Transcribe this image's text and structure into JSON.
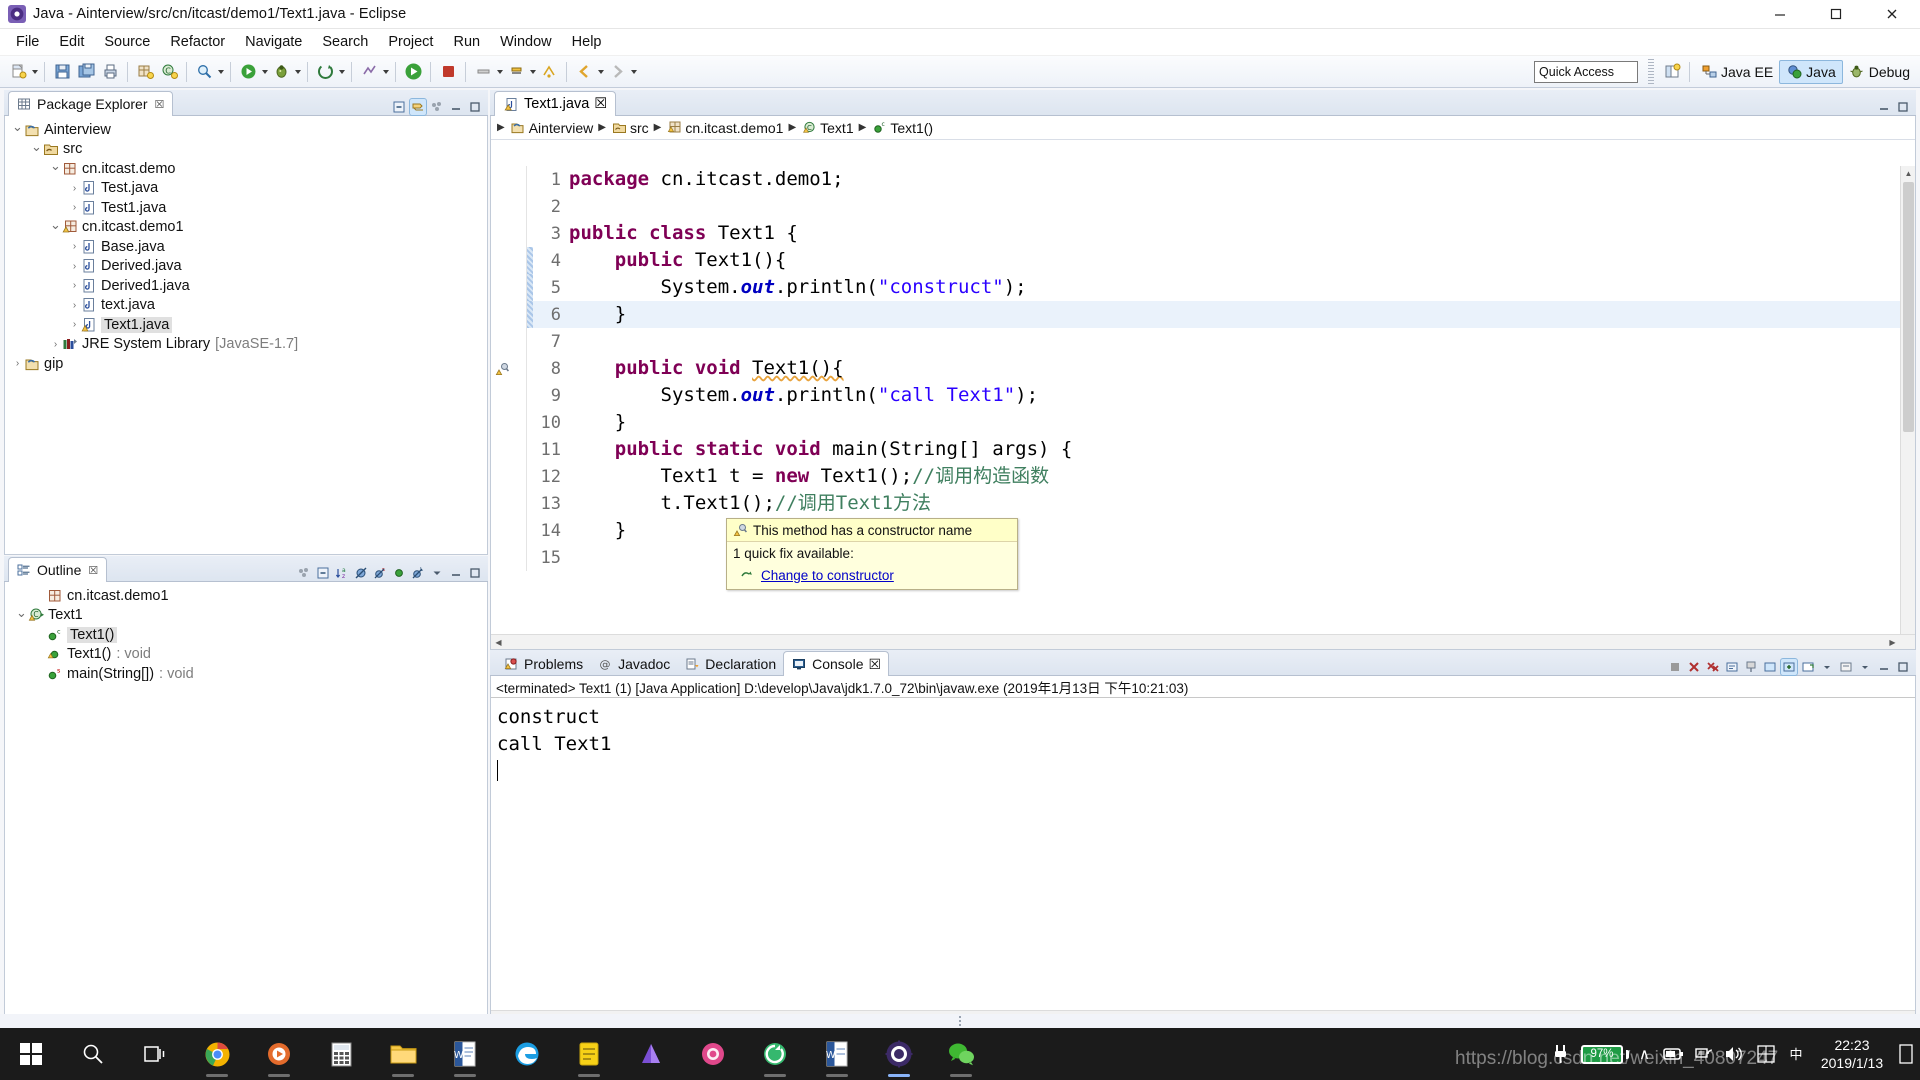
{
  "window": {
    "title": "Java - Ainterview/src/cn/itcast/demo1/Text1.java - Eclipse",
    "app_icon": "eclipse-icon",
    "minimize": "─",
    "maximize": "☐",
    "close": "✕"
  },
  "menubar": {
    "items": [
      {
        "label": "File"
      },
      {
        "label": "Edit"
      },
      {
        "label": "Source"
      },
      {
        "label": "Refactor"
      },
      {
        "label": "Navigate"
      },
      {
        "label": "Search"
      },
      {
        "label": "Project"
      },
      {
        "label": "Run"
      },
      {
        "label": "Window"
      },
      {
        "label": "Help"
      }
    ]
  },
  "toolbar": {
    "quick_access_placeholder": "Quick Access",
    "quick_access_value": "Quick Access",
    "perspectives": [
      {
        "label": "Java EE",
        "icon": "java-ee-perspective-icon",
        "active": false
      },
      {
        "label": "Java",
        "icon": "java-perspective-icon",
        "active": true
      },
      {
        "label": "Debug",
        "icon": "debug-perspective-icon",
        "active": false
      }
    ],
    "open_perspective_tooltip": "Open Perspective"
  },
  "package_explorer": {
    "tab_label": "Package Explorer",
    "close_glyph": "☒",
    "tools": [
      "collapse-all-icon",
      "link-with-editor-icon",
      "view-menu-icon",
      "minimize-icon",
      "maximize-icon"
    ],
    "tree": [
      {
        "depth": 0,
        "twisty": "⌄",
        "icon": "java-project-icon",
        "label": "Ainterview",
        "selected": false,
        "suffix": ""
      },
      {
        "depth": 1,
        "twisty": "⌄",
        "icon": "source-folder-icon",
        "label": "src",
        "selected": false,
        "suffix": ""
      },
      {
        "depth": 2,
        "twisty": "⌄",
        "icon": "package-icon",
        "label": "cn.itcast.demo",
        "selected": false,
        "suffix": ""
      },
      {
        "depth": 3,
        "twisty": "›",
        "icon": "java-file-icon",
        "label": "Test.java",
        "selected": false,
        "suffix": ""
      },
      {
        "depth": 3,
        "twisty": "›",
        "icon": "java-file-icon",
        "label": "Test1.java",
        "selected": false,
        "suffix": ""
      },
      {
        "depth": 2,
        "twisty": "⌄",
        "icon": "package-warning-icon",
        "label": "cn.itcast.demo1",
        "selected": false,
        "suffix": ""
      },
      {
        "depth": 3,
        "twisty": "›",
        "icon": "java-file-icon",
        "label": "Base.java",
        "selected": false,
        "suffix": ""
      },
      {
        "depth": 3,
        "twisty": "›",
        "icon": "java-file-icon",
        "label": "Derived.java",
        "selected": false,
        "suffix": ""
      },
      {
        "depth": 3,
        "twisty": "›",
        "icon": "java-file-icon",
        "label": "Derived1.java",
        "selected": false,
        "suffix": ""
      },
      {
        "depth": 3,
        "twisty": "›",
        "icon": "java-file-icon",
        "label": "text.java",
        "selected": false,
        "suffix": ""
      },
      {
        "depth": 3,
        "twisty": "›",
        "icon": "java-file-warning-icon",
        "label": "Text1.java",
        "selected": true,
        "suffix": ""
      },
      {
        "depth": 2,
        "twisty": "›",
        "icon": "jre-library-icon",
        "label": "JRE System Library",
        "selected": false,
        "suffix": "[JavaSE-1.7]"
      },
      {
        "depth": 0,
        "twisty": "›",
        "icon": "java-project-icon",
        "label": "gip",
        "selected": false,
        "suffix": ""
      }
    ]
  },
  "outline": {
    "tab_label": "Outline",
    "close_glyph": "☒",
    "tools": [
      "view-menu-icon",
      "collapse-all-icon",
      "sort-icon",
      "hide-fields-icon",
      "hide-static-icon",
      "hide-nonpublic-icon",
      "hide-local-icon"
    ],
    "tree": [
      {
        "depth": 1,
        "twisty": "",
        "icon": "package-icon",
        "label": "cn.itcast.demo1",
        "suffix": "",
        "selected": false
      },
      {
        "depth": 0,
        "twisty": "⌄",
        "icon": "class-warning-icon",
        "label": "Text1",
        "suffix": "",
        "selected": false
      },
      {
        "depth": 1,
        "twisty": "",
        "icon": "constructor-icon",
        "label": "Text1()",
        "suffix": "",
        "selected": true
      },
      {
        "depth": 1,
        "twisty": "",
        "icon": "method-warning-icon",
        "label": "Text1()",
        "suffix": ": void",
        "selected": false
      },
      {
        "depth": 1,
        "twisty": "",
        "icon": "static-method-icon",
        "label": "main(String[])",
        "suffix": ": void",
        "selected": false
      }
    ]
  },
  "editor": {
    "tab": {
      "label": "Text1.java",
      "icon": "java-file-warning-icon",
      "close_glyph": "☒"
    },
    "breadcrumb": [
      {
        "label": "Ainterview",
        "icon": "java-project-icon"
      },
      {
        "label": "src",
        "icon": "source-folder-icon"
      },
      {
        "label": "cn.itcast.demo1",
        "icon": "package-warning-icon"
      },
      {
        "label": "Text1",
        "icon": "class-warning-icon"
      },
      {
        "label": "Text1()",
        "icon": "constructor-icon"
      }
    ],
    "lines": [
      {
        "n": 1,
        "highlight": false,
        "changed": false,
        "annotation": "",
        "tokens": [
          {
            "t": "package ",
            "c": "kw"
          },
          {
            "t": "cn.itcast.demo1;",
            "c": ""
          }
        ]
      },
      {
        "n": 2,
        "highlight": false,
        "changed": false,
        "annotation": "",
        "tokens": []
      },
      {
        "n": 3,
        "highlight": false,
        "changed": false,
        "annotation": "",
        "tokens": [
          {
            "t": "public class ",
            "c": "kw"
          },
          {
            "t": "Text1 {",
            "c": ""
          }
        ]
      },
      {
        "n": 4,
        "highlight": false,
        "changed": true,
        "annotation": "",
        "tokens": [
          {
            "t": "    ",
            "c": ""
          },
          {
            "t": "public ",
            "c": "kw"
          },
          {
            "t": "Text1(){",
            "c": ""
          }
        ]
      },
      {
        "n": 5,
        "highlight": false,
        "changed": true,
        "annotation": "",
        "tokens": [
          {
            "t": "        System.",
            "c": ""
          },
          {
            "t": "out",
            "c": "fld"
          },
          {
            "t": ".println(",
            "c": ""
          },
          {
            "t": "\"construct\"",
            "c": "str"
          },
          {
            "t": ");",
            "c": ""
          }
        ]
      },
      {
        "n": 6,
        "highlight": true,
        "changed": true,
        "annotation": "",
        "tokens": [
          {
            "t": "    }",
            "c": ""
          }
        ]
      },
      {
        "n": 7,
        "highlight": false,
        "changed": false,
        "annotation": "",
        "tokens": []
      },
      {
        "n": 8,
        "highlight": false,
        "changed": false,
        "annotation": "quickfix-warning-icon",
        "tokens": [
          {
            "t": "    ",
            "c": ""
          },
          {
            "t": "public void ",
            "c": "kw"
          },
          {
            "t": "Text1(){",
            "c": "err"
          }
        ]
      },
      {
        "n": 9,
        "highlight": false,
        "changed": false,
        "annotation": "",
        "tokens": [
          {
            "t": "        System.",
            "c": ""
          },
          {
            "t": "out",
            "c": "fld"
          },
          {
            "t": ".println(",
            "c": ""
          },
          {
            "t": "\"call Text1\"",
            "c": "str"
          },
          {
            "t": ");",
            "c": ""
          }
        ]
      },
      {
        "n": 10,
        "highlight": false,
        "changed": false,
        "annotation": "",
        "tokens": [
          {
            "t": "    }",
            "c": ""
          }
        ]
      },
      {
        "n": 11,
        "highlight": false,
        "changed": false,
        "annotation": "",
        "tokens": [
          {
            "t": "    ",
            "c": ""
          },
          {
            "t": "public static void ",
            "c": "kw"
          },
          {
            "t": "main(String[] args) {",
            "c": ""
          }
        ]
      },
      {
        "n": 12,
        "highlight": false,
        "changed": false,
        "annotation": "",
        "tokens": [
          {
            "t": "        Text1 t = ",
            "c": ""
          },
          {
            "t": "new ",
            "c": "kw"
          },
          {
            "t": "Text1();",
            "c": ""
          },
          {
            "t": "//调用构造函数",
            "c": "cmt"
          }
        ]
      },
      {
        "n": 13,
        "highlight": false,
        "changed": false,
        "annotation": "",
        "tokens": [
          {
            "t": "        t.Text1();",
            "c": ""
          },
          {
            "t": "//调用Text1方法",
            "c": "cmt"
          }
        ]
      },
      {
        "n": 14,
        "highlight": false,
        "changed": false,
        "annotation": "",
        "tokens": [
          {
            "t": "    }",
            "c": ""
          }
        ]
      },
      {
        "n": 15,
        "highlight": false,
        "changed": false,
        "annotation": "",
        "tokens": []
      }
    ],
    "tooltip": {
      "icon": "quickfix-warning-icon",
      "message": "This method has a constructor name",
      "fix_count_text": "1 quick fix available:",
      "fix_icon": "quickfix-icon",
      "fix_link": "Change to constructor"
    }
  },
  "bottom_panel": {
    "tabs": [
      {
        "label": "Problems",
        "icon": "problems-icon",
        "active": false
      },
      {
        "label": "Javadoc",
        "icon": "javadoc-icon",
        "active": false
      },
      {
        "label": "Declaration",
        "icon": "declaration-icon",
        "active": false
      },
      {
        "label": "Console",
        "icon": "console-icon",
        "active": true,
        "close_glyph": "☒"
      }
    ],
    "tools": [
      "terminate-icon",
      "remove-launch-icon",
      "remove-all-icon",
      "show-console-icon",
      "pin-icon",
      "display-selected-icon",
      "new-console-icon",
      "open-console-icon",
      "scroll-lock-icon",
      "word-wrap-icon",
      "minimize-icon",
      "maximize-icon"
    ],
    "launch_header": "<terminated> Text1 (1) [Java Application] D:\\develop\\Java\\jdk1.7.0_72\\bin\\javaw.exe (2019年1月13日 下午10:21:03)",
    "output_lines": [
      "construct",
      "call Text1"
    ]
  },
  "taskbar": {
    "items": [
      {
        "icon": "windows-start-icon",
        "running": false
      },
      {
        "icon": "search-icon",
        "running": false
      },
      {
        "icon": "task-view-icon",
        "running": false
      },
      {
        "icon": "chrome-icon",
        "running": true
      },
      {
        "icon": "media-player-icon",
        "running": true
      },
      {
        "icon": "calculator-icon",
        "running": false
      },
      {
        "icon": "file-explorer-icon",
        "running": true
      },
      {
        "icon": "word-icon",
        "running": true
      },
      {
        "icon": "edge-icon",
        "running": false
      },
      {
        "icon": "notes-icon",
        "running": true
      },
      {
        "icon": "vector-app-icon",
        "running": false
      },
      {
        "icon": "camera-icon",
        "running": false
      },
      {
        "icon": "recorder-icon",
        "running": true
      },
      {
        "icon": "word-doc-icon",
        "running": true
      },
      {
        "icon": "eclipse-icon",
        "running": true
      },
      {
        "icon": "wechat-icon",
        "running": true
      }
    ],
    "tray": {
      "battery_percent": "97%",
      "chevron": "∧",
      "icons": [
        "power-icon",
        "battery-saver-icon",
        "network-icon",
        "volume-icon",
        "ime-icon",
        "ime-mode-icon"
      ],
      "time": "22:23",
      "date": "2019/1/13"
    },
    "watermark": "https://blog.csdn.net/weixin_40807247"
  }
}
